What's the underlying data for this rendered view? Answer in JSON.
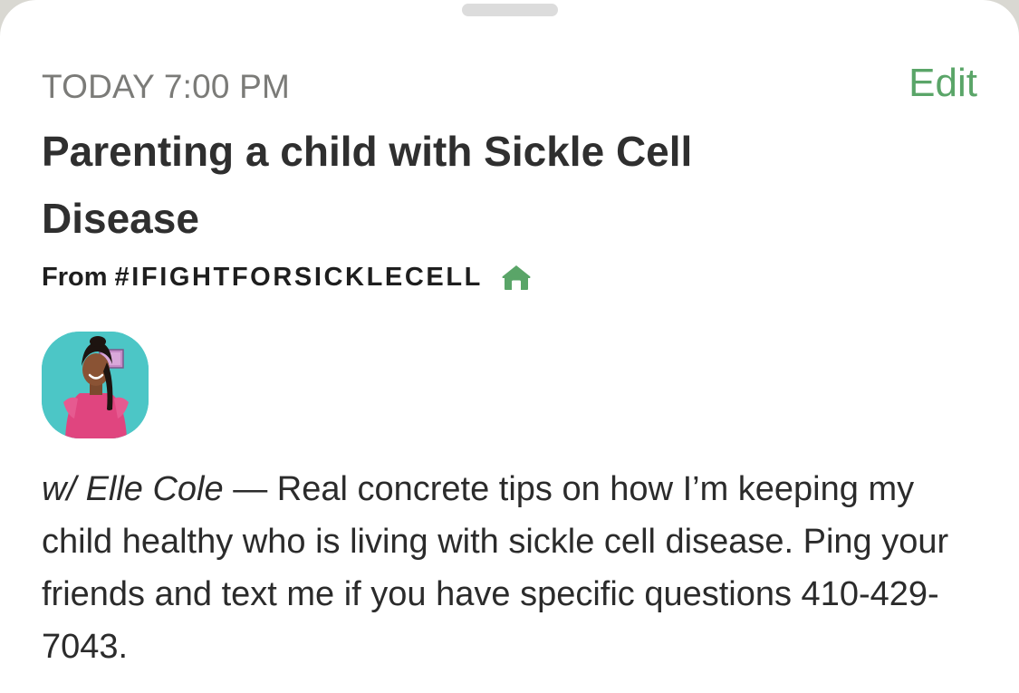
{
  "event": {
    "time": "TODAY 7:00 PM",
    "edit_label": "Edit",
    "title": "Parenting a child with Sickle Cell Disease",
    "from_prefix": "From",
    "club": "#IFIGHTFORSICKLECELL",
    "host_prefix": "w/",
    "host_name": "Elle Cole",
    "separator": " — ",
    "description": "Real concrete tips on how I’m keeping my child healthy who is living with sickle cell disease. Ping your friends and text me if you have specific questions 410-429-7043."
  },
  "icons": {
    "club_icon": "house-icon"
  },
  "colors": {
    "accent": "#5aa568",
    "time_text": "#7b7b78",
    "title_text": "#2f2f2f",
    "avatar_background": "#4cc6c6"
  }
}
